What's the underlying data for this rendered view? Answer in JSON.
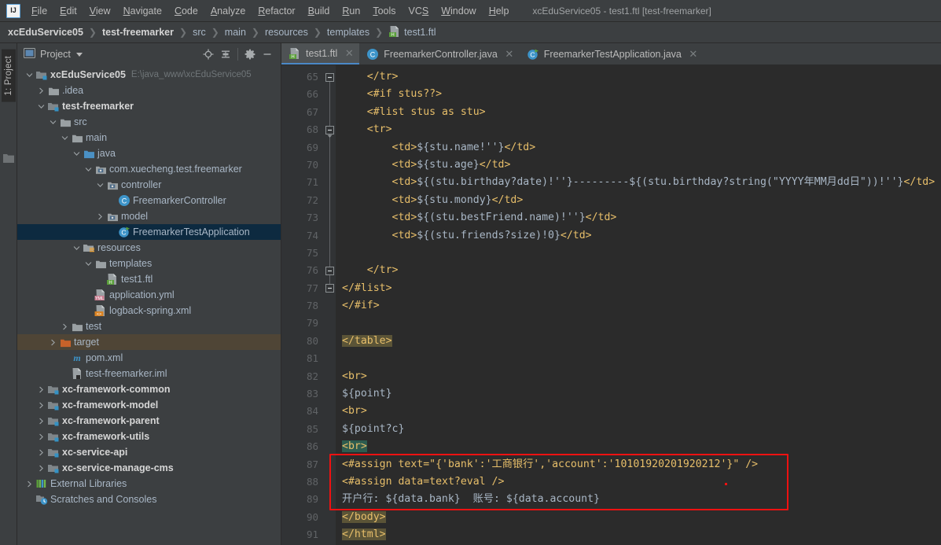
{
  "window": {
    "title": "xcEduService05 - test1.ftl [test-freemarker]",
    "logo_text": "IJ"
  },
  "menubar": {
    "items": [
      {
        "label": "File",
        "mnemonic": "F"
      },
      {
        "label": "Edit",
        "mnemonic": "E"
      },
      {
        "label": "View",
        "mnemonic": "V"
      },
      {
        "label": "Navigate",
        "mnemonic": "N"
      },
      {
        "label": "Code",
        "mnemonic": "C"
      },
      {
        "label": "Analyze",
        "mnemonic": "A"
      },
      {
        "label": "Refactor",
        "mnemonic": "R"
      },
      {
        "label": "Build",
        "mnemonic": "B"
      },
      {
        "label": "Run",
        "mnemonic": "R"
      },
      {
        "label": "Tools",
        "mnemonic": "T"
      },
      {
        "label": "VCS",
        "mnemonic": "S"
      },
      {
        "label": "Window",
        "mnemonic": "W"
      },
      {
        "label": "Help",
        "mnemonic": "H"
      }
    ]
  },
  "breadcrumb": {
    "separator": "❯",
    "items": [
      {
        "label": "xcEduService05",
        "bold": true,
        "icon": null
      },
      {
        "label": "test-freemarker",
        "bold": true,
        "icon": null
      },
      {
        "label": "src",
        "bold": false,
        "icon": null
      },
      {
        "label": "main",
        "bold": false,
        "icon": null
      },
      {
        "label": "resources",
        "bold": false,
        "icon": null
      },
      {
        "label": "templates",
        "bold": false,
        "icon": null
      },
      {
        "label": "test1.ftl",
        "bold": false,
        "icon": "ftl-file-icon"
      }
    ]
  },
  "rail": {
    "project_tab_label": "1: Project"
  },
  "project_panel": {
    "title": "Project",
    "buttons": [
      {
        "name": "locate-icon",
        "tooltip": "Select Opened File"
      },
      {
        "name": "collapse-all-icon",
        "tooltip": "Collapse All"
      },
      {
        "name": "gear-icon",
        "tooltip": "Settings"
      },
      {
        "name": "minimize-icon",
        "tooltip": "Hide"
      }
    ],
    "tree": [
      {
        "label": "xcEduService05",
        "sub": "E:\\java_www\\xcEduService05",
        "depth": 0,
        "arrow": "down",
        "icon": "module-folder-icon",
        "bold": true,
        "state": "normal"
      },
      {
        "label": ".idea",
        "sub": "",
        "depth": 1,
        "arrow": "right",
        "icon": "folder-icon",
        "bold": false,
        "state": "normal"
      },
      {
        "label": "test-freemarker",
        "sub": "",
        "depth": 1,
        "arrow": "down",
        "icon": "module-folder-icon",
        "bold": true,
        "state": "normal"
      },
      {
        "label": "src",
        "sub": "",
        "depth": 2,
        "arrow": "down",
        "icon": "folder-icon",
        "bold": false,
        "state": "normal"
      },
      {
        "label": "main",
        "sub": "",
        "depth": 3,
        "arrow": "down",
        "icon": "folder-icon",
        "bold": false,
        "state": "normal"
      },
      {
        "label": "java",
        "sub": "",
        "depth": 4,
        "arrow": "down",
        "icon": "source-folder-icon",
        "bold": false,
        "state": "normal"
      },
      {
        "label": "com.xuecheng.test.freemarker",
        "sub": "",
        "depth": 5,
        "arrow": "down",
        "icon": "package-icon",
        "bold": false,
        "state": "normal"
      },
      {
        "label": "controller",
        "sub": "",
        "depth": 6,
        "arrow": "down",
        "icon": "package-icon",
        "bold": false,
        "state": "normal"
      },
      {
        "label": "FreemarkerController",
        "sub": "",
        "depth": 7,
        "arrow": "none",
        "icon": "java-class-icon",
        "bold": false,
        "state": "normal"
      },
      {
        "label": "model",
        "sub": "",
        "depth": 6,
        "arrow": "right",
        "icon": "package-icon",
        "bold": false,
        "state": "normal"
      },
      {
        "label": "FreemarkerTestApplication",
        "sub": "",
        "depth": 7,
        "arrow": "none",
        "icon": "java-runnable-class-icon",
        "bold": false,
        "state": "selected"
      },
      {
        "label": "resources",
        "sub": "",
        "depth": 4,
        "arrow": "down",
        "icon": "resources-folder-icon",
        "bold": false,
        "state": "normal"
      },
      {
        "label": "templates",
        "sub": "",
        "depth": 5,
        "arrow": "down",
        "icon": "folder-icon",
        "bold": false,
        "state": "normal"
      },
      {
        "label": "test1.ftl",
        "sub": "",
        "depth": 6,
        "arrow": "none",
        "icon": "ftl-file-icon",
        "bold": false,
        "state": "normal"
      },
      {
        "label": "application.yml",
        "sub": "",
        "depth": 5,
        "arrow": "none",
        "icon": "yml-file-icon",
        "bold": false,
        "state": "normal"
      },
      {
        "label": "logback-spring.xml",
        "sub": "",
        "depth": 5,
        "arrow": "none",
        "icon": "xml-file-icon",
        "bold": false,
        "state": "normal"
      },
      {
        "label": "test",
        "sub": "",
        "depth": 3,
        "arrow": "right",
        "icon": "folder-icon",
        "bold": false,
        "state": "normal"
      },
      {
        "label": "target",
        "sub": "",
        "depth": 2,
        "arrow": "right",
        "icon": "excluded-folder-icon",
        "bold": false,
        "state": "target-hl"
      },
      {
        "label": "pom.xml",
        "sub": "",
        "depth": 3,
        "arrow": "none",
        "icon": "maven-icon",
        "bold": false,
        "state": "normal"
      },
      {
        "label": "test-freemarker.iml",
        "sub": "",
        "depth": 3,
        "arrow": "none",
        "icon": "iml-file-icon",
        "bold": false,
        "state": "normal"
      },
      {
        "label": "xc-framework-common",
        "sub": "",
        "depth": 1,
        "arrow": "right",
        "icon": "module-folder-icon",
        "bold": true,
        "state": "normal"
      },
      {
        "label": "xc-framework-model",
        "sub": "",
        "depth": 1,
        "arrow": "right",
        "icon": "module-folder-icon",
        "bold": true,
        "state": "normal"
      },
      {
        "label": "xc-framework-parent",
        "sub": "",
        "depth": 1,
        "arrow": "right",
        "icon": "module-folder-icon",
        "bold": true,
        "state": "normal"
      },
      {
        "label": "xc-framework-utils",
        "sub": "",
        "depth": 1,
        "arrow": "right",
        "icon": "module-folder-icon",
        "bold": true,
        "state": "normal"
      },
      {
        "label": "xc-service-api",
        "sub": "",
        "depth": 1,
        "arrow": "right",
        "icon": "module-folder-icon",
        "bold": true,
        "state": "normal"
      },
      {
        "label": "xc-service-manage-cms",
        "sub": "",
        "depth": 1,
        "arrow": "right",
        "icon": "module-folder-icon",
        "bold": true,
        "state": "normal"
      },
      {
        "label": "External Libraries",
        "sub": "",
        "depth": 0,
        "arrow": "right",
        "icon": "libraries-icon",
        "bold": false,
        "state": "normal"
      },
      {
        "label": "Scratches and Consoles",
        "sub": "",
        "depth": 0,
        "arrow": "none",
        "icon": "scratches-icon",
        "bold": false,
        "state": "normal"
      }
    ]
  },
  "editor": {
    "tabs": [
      {
        "label": "test1.ftl",
        "icon": "ftl-file-icon",
        "active": true,
        "closable": true
      },
      {
        "label": "FreemarkerController.java",
        "icon": "java-class-icon",
        "active": false,
        "closable": true
      },
      {
        "label": "FreemarkerTestApplication.java",
        "icon": "java-runnable-class-icon",
        "active": false,
        "closable": true
      }
    ],
    "first_line_number": 65,
    "lines": [
      {
        "n": 65,
        "text": "    </tr>",
        "fold": "end-top",
        "bg": "none"
      },
      {
        "n": 66,
        "text": "    <#if stus??>",
        "fold": "line",
        "bg": "none"
      },
      {
        "n": 67,
        "text": "    <#list stus as stu>",
        "fold": "line",
        "bg": "none"
      },
      {
        "n": 68,
        "text": "    <tr>",
        "fold": "start",
        "bg": "none"
      },
      {
        "n": 69,
        "text": "        <td>${stu.name!''}</td>",
        "fold": "line",
        "bg": "none"
      },
      {
        "n": 70,
        "text": "        <td>${stu.age}</td>",
        "fold": "line",
        "bg": "none"
      },
      {
        "n": 71,
        "text": "        <td>${(stu.birthday?date)!''}---------${(stu.birthday?string(\"YYYY年MM月dd日\"))!''}</td>",
        "fold": "line",
        "bg": "none"
      },
      {
        "n": 72,
        "text": "        <td>${stu.mondy}</td>",
        "fold": "line",
        "bg": "none"
      },
      {
        "n": 73,
        "text": "        <td>${(stu.bestFriend.name)!''}</td>",
        "fold": "line",
        "bg": "none"
      },
      {
        "n": 74,
        "text": "        <td>${(stu.friends?size)!0}</td>",
        "fold": "line",
        "bg": "none"
      },
      {
        "n": 75,
        "text": "",
        "fold": "line",
        "bg": "none"
      },
      {
        "n": 76,
        "text": "    </tr>",
        "fold": "end",
        "bg": "none"
      },
      {
        "n": 77,
        "text": "</#list>",
        "fold": "end",
        "bg": "none"
      },
      {
        "n": 78,
        "text": "</#if>",
        "fold": "none",
        "bg": "none"
      },
      {
        "n": 79,
        "text": "",
        "fold": "none",
        "bg": "none"
      },
      {
        "n": 80,
        "text": "</table>",
        "fold": "none",
        "bg": "olive"
      },
      {
        "n": 81,
        "text": "",
        "fold": "none",
        "bg": "none"
      },
      {
        "n": 82,
        "text": "<br>",
        "fold": "none",
        "bg": "none"
      },
      {
        "n": 83,
        "text": "${point}",
        "fold": "none",
        "bg": "none"
      },
      {
        "n": 84,
        "text": "<br>",
        "fold": "none",
        "bg": "none"
      },
      {
        "n": 85,
        "text": "${point?c}",
        "fold": "none",
        "bg": "none"
      },
      {
        "n": 86,
        "text": "<br>",
        "fold": "none",
        "bg": "teal"
      },
      {
        "n": 87,
        "text": "<#assign text=\"{'bank':'工商银行','account':'10101920201920212'}\" />",
        "fold": "none",
        "bg": "none"
      },
      {
        "n": 88,
        "text": "<#assign data=text?eval />",
        "fold": "none",
        "bg": "none"
      },
      {
        "n": 89,
        "text": "开户行: ${data.bank}  账号: ${data.account}",
        "fold": "none",
        "bg": "none"
      },
      {
        "n": 90,
        "text": "</body>",
        "fold": "none",
        "bg": "olive"
      },
      {
        "n": 91,
        "text": "</html>",
        "fold": "none",
        "bg": "olive"
      }
    ],
    "annotation": {
      "name": "red-highlight-box",
      "color": "#ee1111",
      "covers_lines": [
        87,
        88,
        89
      ]
    }
  },
  "colors": {
    "background": "#3c3f41",
    "editor_bg": "#2b2b2b",
    "gutter_bg": "#313335",
    "tag": "#e8bf6a",
    "text": "#a9b7c6",
    "selection": "#0d2a40",
    "accent": "#4a88c7",
    "annotation_red": "#ee1111",
    "olive_highlight": "#5b5437",
    "teal_highlight": "#2d5c4f"
  }
}
